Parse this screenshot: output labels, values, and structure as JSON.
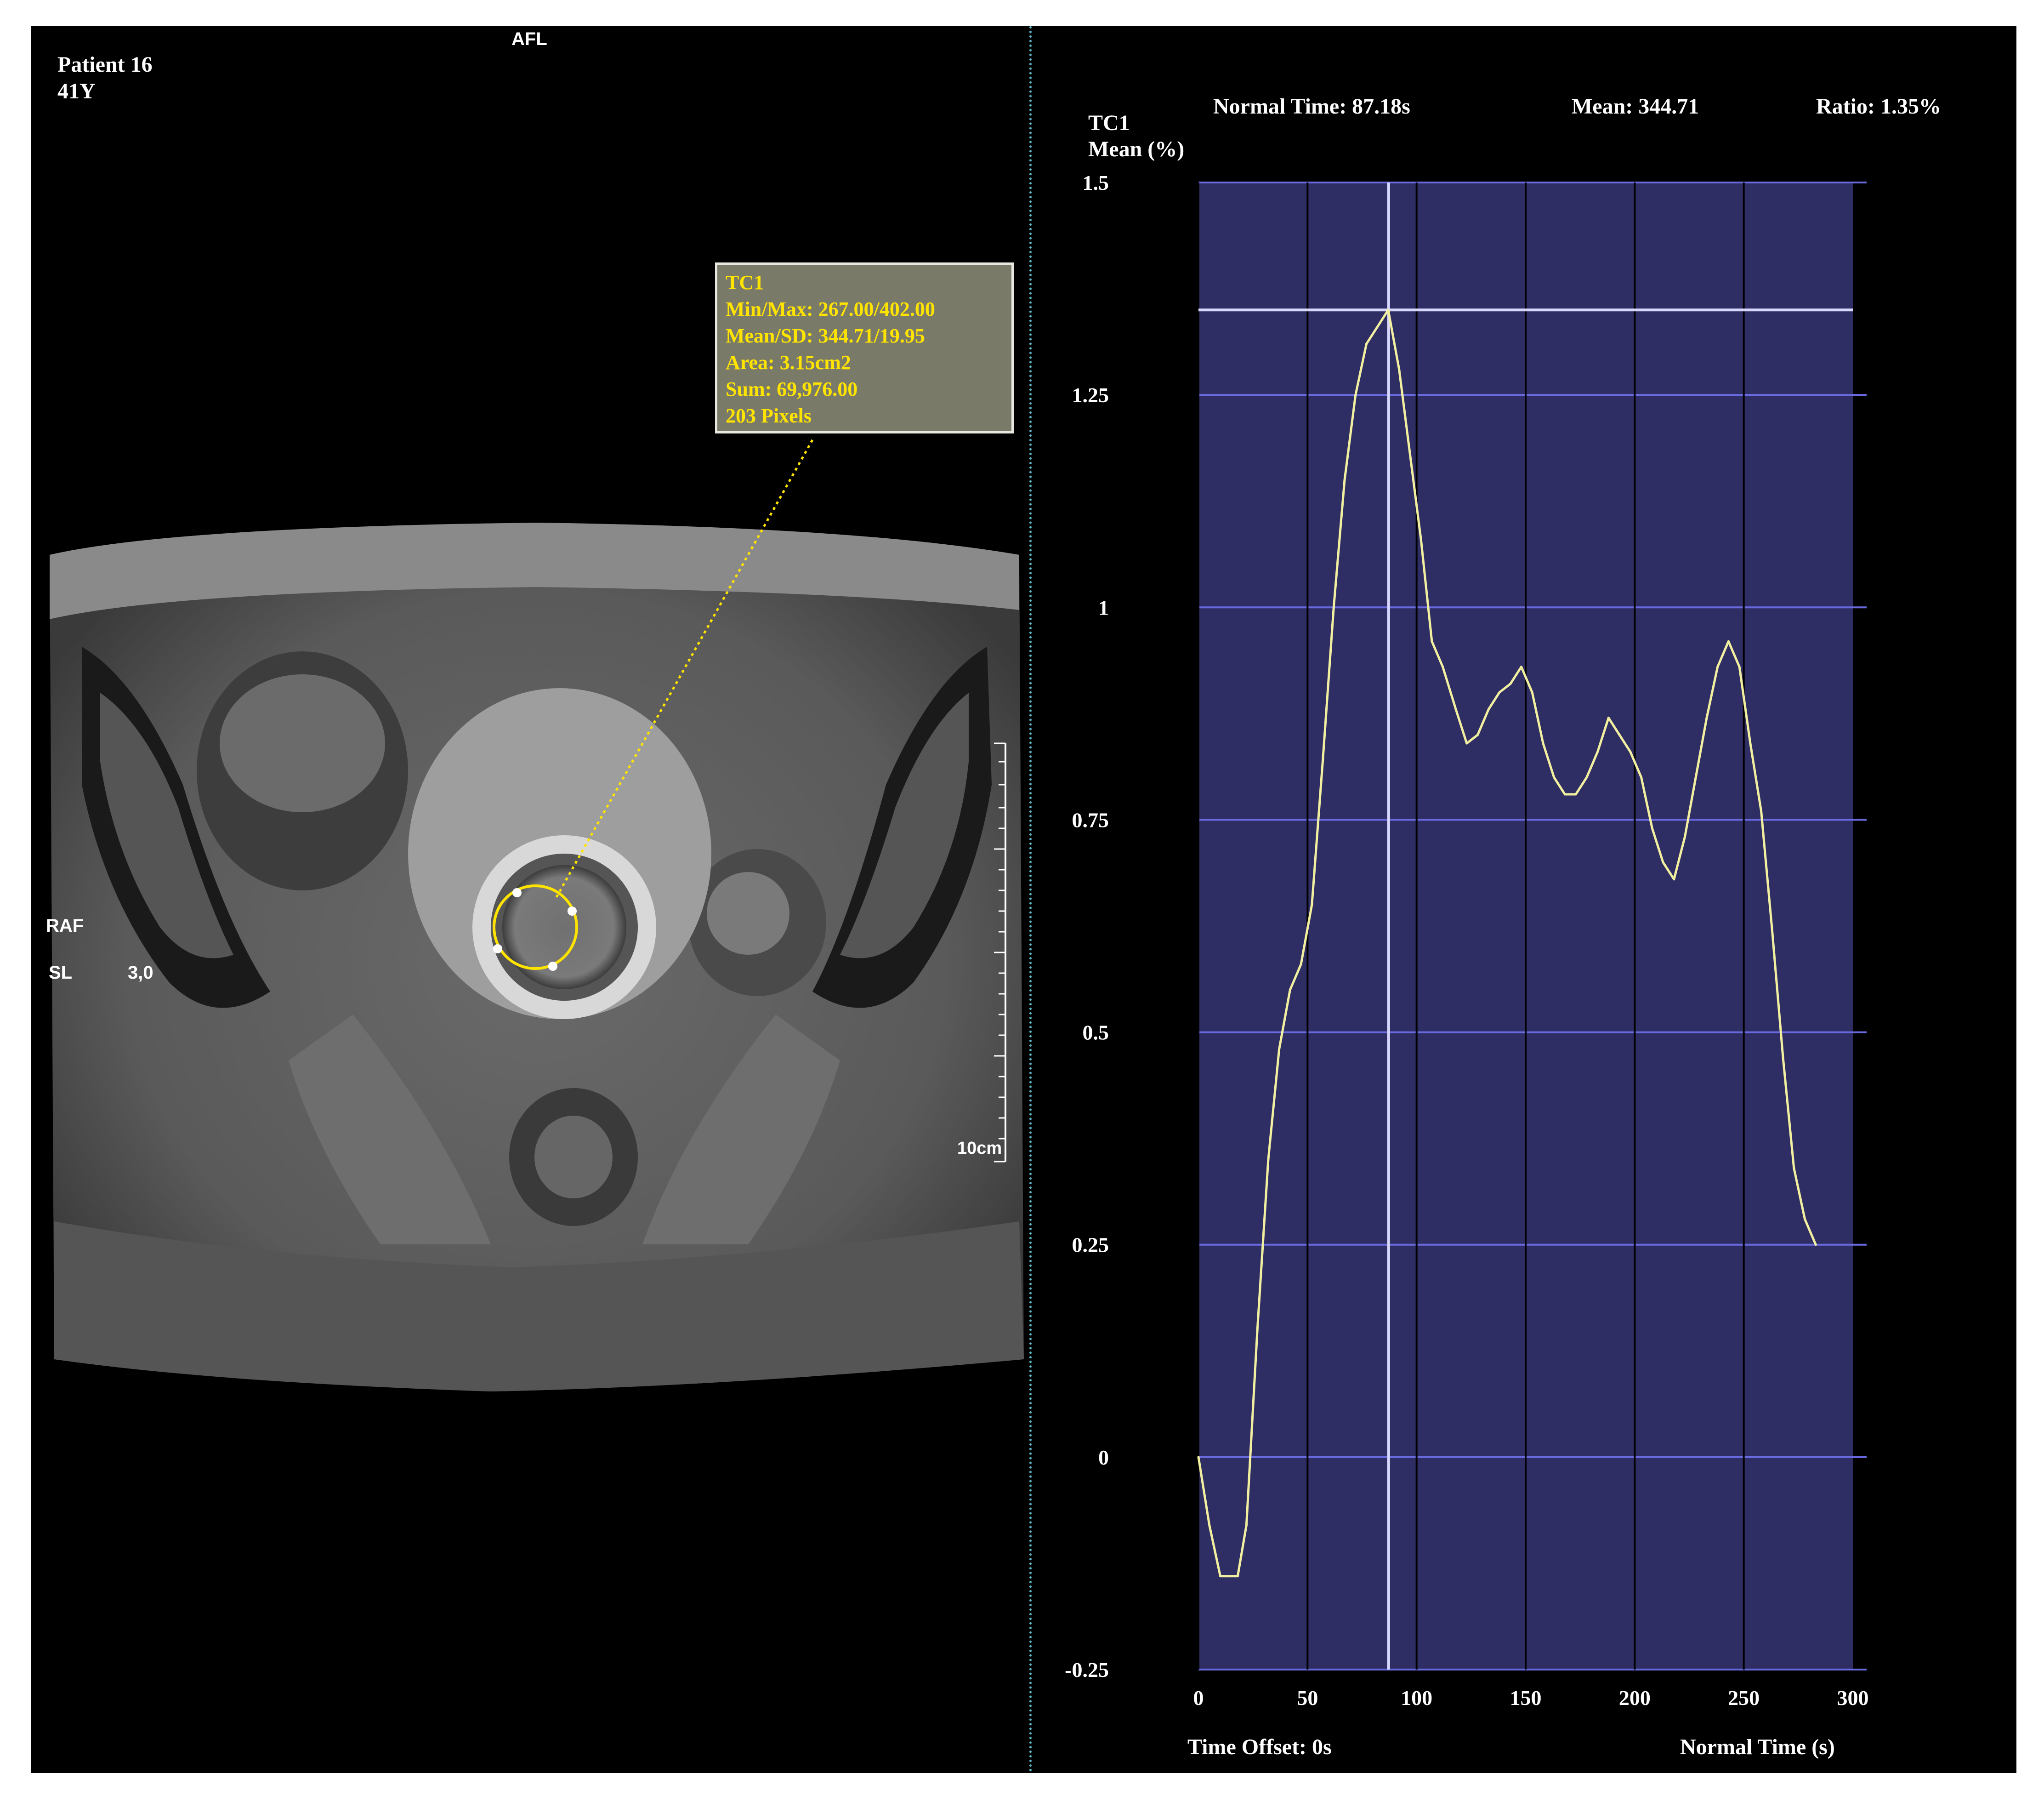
{
  "left_panel": {
    "patient_name": "Patient 16",
    "patient_age": "41Y",
    "orientation_top": "AFL",
    "orientation_left": "RAF",
    "slice_label": "SL",
    "slice_value": "3,0",
    "scale_label": "10cm",
    "roi": {
      "title": "TC1",
      "minmax": "Min/Max: 267.00/402.00",
      "mean_sd": "Mean/SD: 344.71/19.95",
      "area": "Area: 3.15cm2",
      "sum": "Sum: 69,976.00",
      "pixels": "203 Pixels"
    },
    "colors": {
      "roi_text": "#ffe400",
      "roi_box": "#7a7a68"
    }
  },
  "right_panel": {
    "header": {
      "normal_time": "Normal Time: 87.18s",
      "mean": "Mean: 344.71",
      "ratio": "Ratio: 1.35%"
    },
    "y_title_line1": "TC1",
    "y_title_line2": "Mean (%)",
    "time_offset": "Time Offset: 0s",
    "x_title": "Normal Time (s)",
    "colors": {
      "plot_bg": "#2f2e64",
      "grid": "#6a6ae0",
      "curve": "#f2f0a0",
      "cursor": "#d8d8ff"
    }
  },
  "chart_data": {
    "type": "line",
    "title": "",
    "xlabel": "Normal Time (s)",
    "ylabel": "TC1 Mean (%)",
    "xlim": [
      0,
      300
    ],
    "ylim": [
      -0.25,
      1.5
    ],
    "x_ticks": [
      "0",
      "50",
      "100",
      "150",
      "200",
      "250",
      "300"
    ],
    "y_ticks": [
      "1.5",
      "1.25",
      "1",
      "0.75",
      "0.5",
      "0.25",
      "0",
      "-0.25"
    ],
    "grid": true,
    "cursor_x": 87.18,
    "cursor_y": 1.35,
    "series": [
      {
        "x": [
          0,
          5,
          10,
          15,
          18,
          22,
          27,
          32,
          37,
          42,
          47,
          52,
          57,
          62,
          67,
          72,
          77,
          82,
          87,
          92,
          97,
          102,
          107,
          112,
          118,
          123,
          128,
          133,
          138,
          143,
          148,
          153,
          158,
          163,
          168,
          173,
          178,
          183,
          188,
          193,
          198,
          203,
          208,
          213,
          218,
          223,
          228,
          233,
          238,
          243,
          248,
          253,
          258,
          263,
          268,
          273,
          278,
          283
        ],
        "y": [
          0,
          -0.08,
          -0.14,
          -0.14,
          -0.14,
          -0.08,
          0.15,
          0.35,
          0.48,
          0.55,
          0.58,
          0.65,
          0.82,
          1.0,
          1.15,
          1.25,
          1.31,
          1.33,
          1.35,
          1.28,
          1.18,
          1.08,
          0.96,
          0.93,
          0.88,
          0.84,
          0.85,
          0.88,
          0.9,
          0.91,
          0.93,
          0.9,
          0.84,
          0.8,
          0.78,
          0.78,
          0.8,
          0.83,
          0.87,
          0.85,
          0.83,
          0.8,
          0.74,
          0.7,
          0.68,
          0.73,
          0.8,
          0.87,
          0.93,
          0.96,
          0.93,
          0.84,
          0.76,
          0.62,
          0.47,
          0.34,
          0.28,
          0.25
        ]
      }
    ]
  }
}
